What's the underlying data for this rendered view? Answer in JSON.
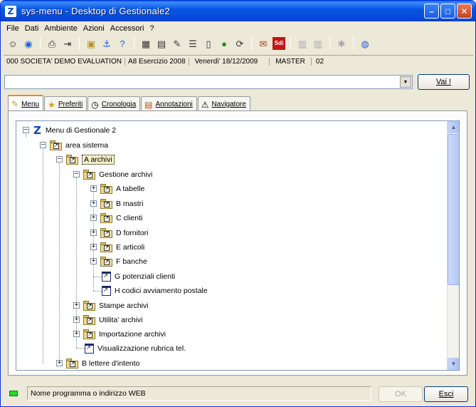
{
  "window": {
    "title": "sys-menu - Desktop di Gestionale2",
    "icon_letter": "Z",
    "minimize": "–",
    "maximize": "□",
    "close": "✕"
  },
  "menu": [
    "File",
    "Dati",
    "Ambiente",
    "Azioni",
    "Accessori",
    "?"
  ],
  "toolbar": {
    "icons": [
      "user-icon",
      "globe-icon",
      "printer-icon",
      "export-icon",
      "folder-icon",
      "anchor-icon",
      "help-icon",
      "calculator-icon",
      "document-icon",
      "notes-icon",
      "list-icon",
      "page-icon",
      "earth-icon",
      "refresh-icon",
      "mail-icon",
      "sdi-icon",
      "grid-icon",
      "grid-icon",
      "tools-icon",
      "info-icon"
    ],
    "sdi_label": "Sdi"
  },
  "context": {
    "company": "000 SOCIETA' DEMO EVALUATION",
    "exercise": "A8 Esercizio 2008",
    "date": "Venerdi' 18/12/2009",
    "user": "MASTER",
    "code": "02"
  },
  "address": {
    "value": "",
    "go_button": "Vai !"
  },
  "tabs": [
    {
      "label": "Menu",
      "icon": "folder-open-icon",
      "active": true
    },
    {
      "label": "Preferiti",
      "icon": "star-icon",
      "active": false
    },
    {
      "label": "Cronologia",
      "icon": "clock-icon",
      "active": false
    },
    {
      "label": "Annotazioni",
      "icon": "notes-icon",
      "active": false
    },
    {
      "label": "Navigatore",
      "icon": "navigator-icon",
      "active": false
    }
  ],
  "tree": {
    "root": "Menu di Gestionale 2",
    "area": "area sistema",
    "archivi": "A archivi",
    "gestione": "Gestione archivi",
    "items": [
      "A tabelle",
      "B mastri",
      "C clienti",
      "D fornitori",
      "E articoli",
      "F banche"
    ],
    "programs": [
      "G potenziali clienti",
      "H codici avviamento postale"
    ],
    "siblings": [
      "Stampe archivi",
      "Utilita' archivi",
      "Importazione archivi"
    ],
    "rubrica": "Visualizzazione rubrica tel.",
    "lettere": "B lettere d'intento"
  },
  "status": {
    "text": "Nome programma o indirizzo WEB",
    "ok": "OK",
    "exit": "Esci"
  }
}
